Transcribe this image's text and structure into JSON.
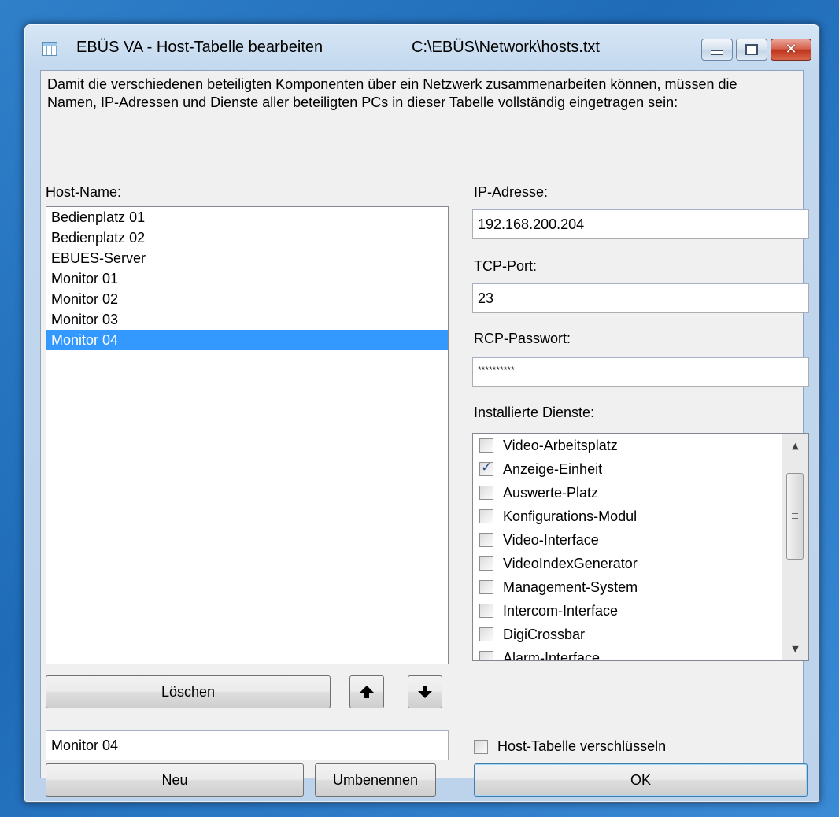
{
  "window": {
    "title": "EBÜS VA - Host-Tabelle bearbeiten",
    "path": "C:\\EBÜS\\Network\\hosts.txt"
  },
  "description": "Damit die verschiedenen beteiligten Komponenten über ein Netzwerk zusammenarbeiten können, müssen die Namen, IP-Adressen und Dienste aller beteiligten PCs in dieser Tabelle vollständig eingetragen sein:",
  "hosts": {
    "label": "Host-Name:",
    "items": [
      "Bedienplatz 01",
      "Bedienplatz 02",
      "EBUES-Server",
      "Monitor 01",
      "Monitor 02",
      "Monitor 03",
      "Monitor 04"
    ],
    "selected_index": 6,
    "delete_label": "Löschen",
    "name_value": "Monitor 04",
    "new_label": "Neu",
    "rename_label": "Umbenennen"
  },
  "ip": {
    "label": "IP-Adresse:",
    "value": "192.168.200.204"
  },
  "tcp": {
    "label": "TCP-Port:",
    "value": "23"
  },
  "rcp": {
    "label": "RCP-Passwort:",
    "value": "**********"
  },
  "services": {
    "label": "Installierte Dienste:",
    "items": [
      {
        "label": "Video-Arbeitsplatz",
        "checked": false
      },
      {
        "label": "Anzeige-Einheit",
        "checked": true
      },
      {
        "label": "Auswerte-Platz",
        "checked": false
      },
      {
        "label": "Konfigurations-Modul",
        "checked": false
      },
      {
        "label": "Video-Interface",
        "checked": false
      },
      {
        "label": "VideoIndexGenerator",
        "checked": false
      },
      {
        "label": "Management-System",
        "checked": false
      },
      {
        "label": "Intercom-Interface",
        "checked": false
      },
      {
        "label": "DigiCrossbar",
        "checked": false
      },
      {
        "label": "Alarm-Interface",
        "checked": false
      }
    ]
  },
  "encrypt": {
    "label": "Host-Tabelle verschlüsseln",
    "checked": false
  },
  "ok_label": "OK",
  "colors": {
    "selection": "#3399ff",
    "client_bg": "#f0f0f0"
  }
}
